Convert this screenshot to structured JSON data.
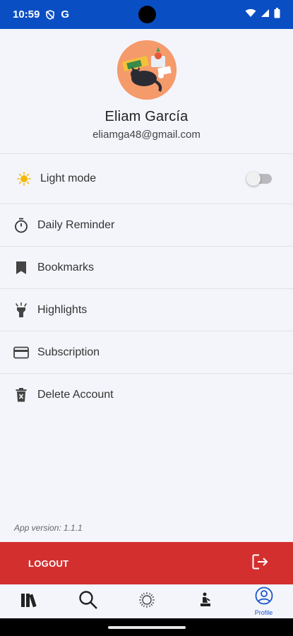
{
  "status_bar": {
    "time": "10:59",
    "g_label": "G"
  },
  "profile": {
    "name": "Eliam García",
    "email": "eliamga48@gmail.com"
  },
  "menu": {
    "light_mode": {
      "label": "Light mode",
      "toggle_on": false
    },
    "items": [
      {
        "label": "Daily Reminder",
        "icon": "timer-icon"
      },
      {
        "label": "Bookmarks",
        "icon": "bookmark-icon"
      },
      {
        "label": "Highlights",
        "icon": "highlighter-icon"
      },
      {
        "label": "Subscription",
        "icon": "credit-card-icon"
      },
      {
        "label": "Delete Account",
        "icon": "delete-icon"
      }
    ]
  },
  "app_version": "App version: 1.1.1",
  "logout": {
    "label": "LOGOUT"
  },
  "bottom_nav": {
    "items": [
      {
        "icon": "library-icon"
      },
      {
        "icon": "search-icon"
      },
      {
        "icon": "sun-icon"
      },
      {
        "icon": "meditation-icon"
      },
      {
        "icon": "profile-icon",
        "label": "Profile"
      }
    ],
    "active": "Profile"
  },
  "colors": {
    "status_bar": "#0a4ec4",
    "background": "#f4f5fb",
    "logout_red": "#d32f2f",
    "accent_blue": "#1a56c8",
    "avatar_orange": "#f59a6b"
  }
}
